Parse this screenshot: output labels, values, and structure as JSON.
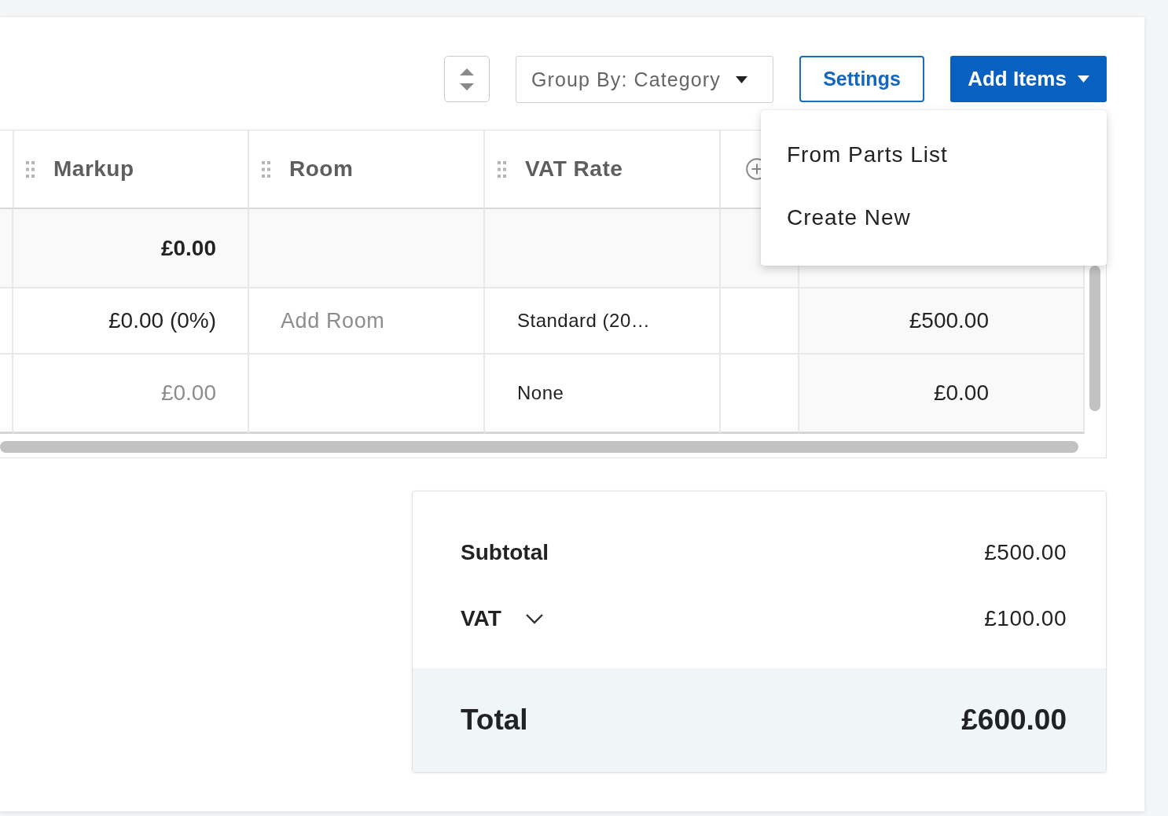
{
  "toolbar": {
    "group_by": {
      "value": "Group By: Category"
    },
    "settings_button": {
      "label": "Settings"
    },
    "add_items_button": {
      "label": "Add Items",
      "expanded": true
    }
  },
  "add_items_menu": {
    "items": [
      {
        "label": "From Parts List"
      },
      {
        "label": "Create New"
      }
    ]
  },
  "table": {
    "columns": [
      {
        "kind": "blank"
      },
      {
        "kind": "field",
        "label": "Markup"
      },
      {
        "kind": "field",
        "label": "Room"
      },
      {
        "kind": "field",
        "label": "VAT Rate"
      },
      {
        "kind": "add"
      },
      {
        "kind": "blank"
      }
    ],
    "rows": [
      {
        "kind": "group",
        "markup": {
          "text": "£0.00",
          "muted": false
        }
      },
      {
        "kind": "item",
        "markup": {
          "text": "£0.00 (0%)",
          "muted": false
        },
        "room": {
          "placeholder": "Add Room"
        },
        "vat_rate": "Standard (20…",
        "column_6": "£500.00"
      },
      {
        "kind": "item",
        "markup": {
          "text": "£0.00",
          "muted": true
        },
        "vat_rate": "None",
        "column_6": "£0.00"
      }
    ]
  },
  "totals": {
    "subtotal": {
      "label": "Subtotal",
      "value": "£500.00"
    },
    "vat": {
      "label": "VAT",
      "value": "£100.00",
      "expanded": false
    },
    "total": {
      "label": "Total",
      "value": "£600.00"
    }
  }
}
